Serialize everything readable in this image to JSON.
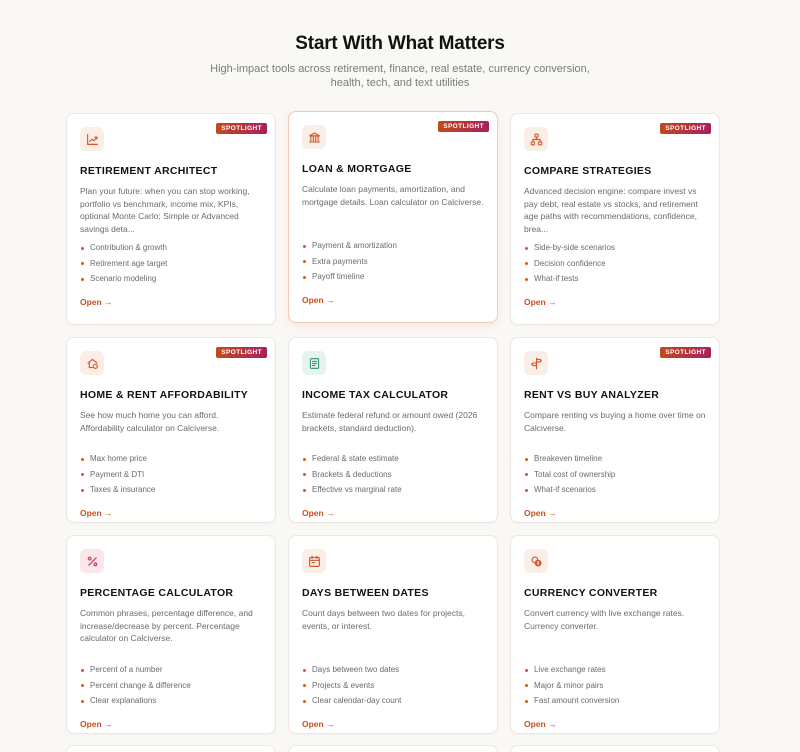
{
  "header": {
    "title": "Start With What Matters",
    "subtitle": "High-impact tools across retirement, finance, real estate, currency conversion, health, tech, and text utilities"
  },
  "colors": {
    "accent": "#c8501f",
    "badge_start": "#c24a1b",
    "badge_end": "#a5205e",
    "background": "#faf8f5"
  },
  "cards": [
    {
      "icon": "line-chart-icon",
      "badge": "SPOTLIGHT",
      "title": "RETIREMENT ARCHITECT",
      "description": "Plan your future: when you can stop working, portfolio vs benchmark, income mix, KPIs, optional Monte Carlo; Simple or Advanced savings deta...",
      "features": [
        "Contribution & growth",
        "Retirement age target",
        "Scenario modeling"
      ],
      "link": "Open →"
    },
    {
      "icon": "bank-icon",
      "badge": "SPOTLIGHT",
      "title": "LOAN & MORTGAGE",
      "description": "Calculate loan payments, amortization, and mortgage details. Loan calculator on Calciverse.",
      "features": [
        "Payment & amortization",
        "Extra payments",
        "Payoff timeline"
      ],
      "link": "Open →"
    },
    {
      "icon": "network-icon",
      "badge": "SPOTLIGHT",
      "title": "COMPARE STRATEGIES",
      "description": "Advanced decision engine: compare invest vs pay debt, real estate vs stocks, and retirement age paths with recommendations, confidence, brea...",
      "features": [
        "Side-by-side scenarios",
        "Decision confidence",
        "What-if tests"
      ],
      "link": "Open →"
    },
    {
      "icon": "home-dollar-icon",
      "badge": "SPOTLIGHT",
      "title": "HOME & RENT AFFORDABILITY",
      "description": "See how much home you can afford. Affordability calculator on Calciverse.",
      "features": [
        "Max home price",
        "Payment & DTI",
        "Taxes & insurance"
      ],
      "link": "Open →"
    },
    {
      "icon": "receipt-icon",
      "badge": "",
      "title": "INCOME TAX CALCULATOR",
      "description": "Estimate federal refund or amount owed (2026 brackets, standard deduction).",
      "features": [
        "Federal & state estimate",
        "Brackets & deductions",
        "Effective vs marginal rate"
      ],
      "link": "Open →"
    },
    {
      "icon": "signpost-icon",
      "badge": "SPOTLIGHT",
      "title": "RENT VS BUY ANALYZER",
      "description": "Compare renting vs buying a home over time on Calciverse.",
      "features": [
        "Breakeven timeline",
        "Total cost of ownership",
        "What-if scenarios"
      ],
      "link": "Open →"
    },
    {
      "icon": "percent-icon",
      "badge": "",
      "title": "PERCENTAGE CALCULATOR",
      "description": "Common phrases, percentage difference, and increase/decrease by percent. Percentage calculator on Calciverse.",
      "features": [
        "Percent of a number",
        "Percent change & difference",
        "Clear explanations"
      ],
      "link": "Open →"
    },
    {
      "icon": "calendar-icon",
      "badge": "",
      "title": "DAYS BETWEEN DATES",
      "description": "Count days between two dates for projects, events, or interest.",
      "features": [
        "Days between two dates",
        "Projects & events",
        "Clear calendar-day count"
      ],
      "link": "Open →"
    },
    {
      "icon": "coins-icon",
      "badge": "",
      "title": "CURRENCY CONVERTER",
      "description": "Convert currency with live exchange rates. Currency converter.",
      "features": [
        "Live exchange rates",
        "Major & minor pairs",
        "Fast amount conversion"
      ],
      "link": "Open →"
    }
  ]
}
